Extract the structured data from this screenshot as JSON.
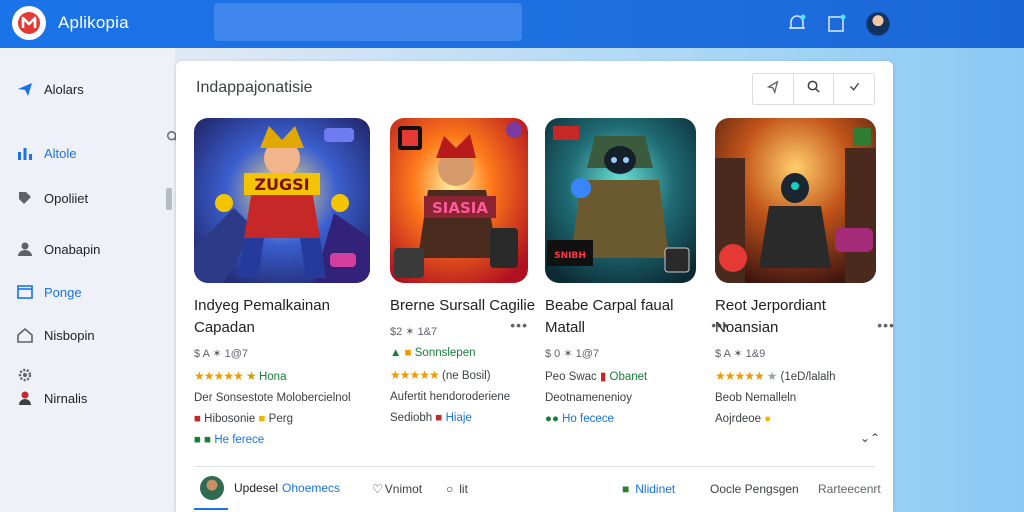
{
  "app": {
    "title": "Aplikopia"
  },
  "search": {
    "placeholder": ""
  },
  "sidebar": {
    "items": [
      {
        "label": "Alolars",
        "icon": "share-arrow-icon"
      },
      {
        "label": "Altole",
        "icon": "bar-chart-icon"
      },
      {
        "label": "Opoliiet",
        "icon": "tag-icon"
      },
      {
        "label": "Onabapin",
        "icon": "person-icon"
      },
      {
        "label": "Ponge",
        "icon": "browser-icon"
      },
      {
        "label": "Nisbopin",
        "icon": "home-icon"
      },
      {
        "label": "",
        "icon": "settings-icon"
      },
      {
        "label": "Nirnalis",
        "icon": "account-icon"
      }
    ]
  },
  "main": {
    "title": "Indappajonatisie",
    "games": [
      {
        "title": "Indyeg Pemalkainan Capadan",
        "meta": "$ A ✶ 1@7",
        "rating_label": "Hona",
        "line1": "Der Sonsestote Molobercielnol",
        "line2": "Hibosonie",
        "line2b": "Perg",
        "line3": "He ferece"
      },
      {
        "title": "Brerne Sursall Cagilie",
        "meta": "$2 ✶ 1&7",
        "rating_label": "Sonnslepen",
        "line1": "(ne Bosil)",
        "line2": "Aufertit hendoroderiene",
        "line3": "Sediobh",
        "line3b": "Hiaje"
      },
      {
        "title": "Beabe Carpal faual Matall",
        "meta": "$ 0 ✶ 1@7",
        "rating_label": "Peo Swac",
        "rating_label2": "Obanet",
        "line1": "Deotnamenenioy",
        "line2": "Ho fecece"
      },
      {
        "title": "Reot Jerpordiant Noansian",
        "meta": "$ A ✶ 1&9",
        "rating_label": "(1eD/lalalh",
        "line1": "Beob Nemalleln",
        "line2": "Aojrdeoe"
      }
    ],
    "bottom": {
      "updates": "Updesel",
      "updates_sub": "Ohoemecs",
      "item2": "Vnimot",
      "item3": "lit",
      "item4": "Nlidinet",
      "item5": "Oocle Pengsgen",
      "item6": "Rarteecenrt"
    }
  },
  "colors": {
    "accent": "#1a73e8",
    "star": "#f29900",
    "green": "#188038"
  }
}
